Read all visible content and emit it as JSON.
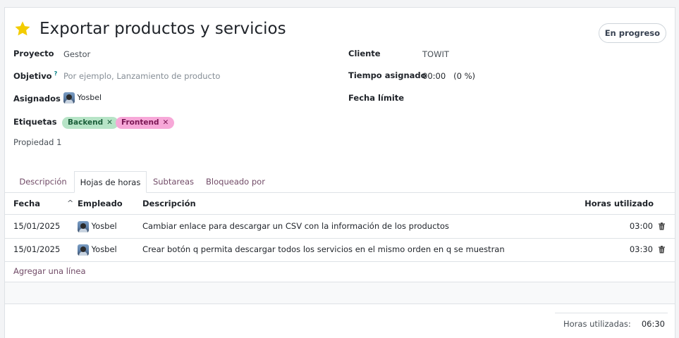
{
  "task": {
    "title": "Exportar productos y servicios",
    "stage": "En progreso",
    "star_color": "#f3cc00"
  },
  "fields": {
    "project": {
      "label": "Proyecto",
      "value": "Gestor"
    },
    "objective": {
      "label": "Objetivo",
      "help": "?",
      "placeholder": "Por ejemplo, Lanzamiento de producto"
    },
    "assignees": {
      "label": "Asignados",
      "value": "Yosbel"
    },
    "tags": {
      "label": "Etiquetas",
      "items": [
        {
          "name": "Backend",
          "color": "#b7e4c7"
        },
        {
          "name": "Frontend",
          "color": "#f7a8d8"
        }
      ]
    },
    "property": {
      "label": "Propiedad 1"
    },
    "customer": {
      "label": "Cliente",
      "value": "TOWIT"
    },
    "allocated": {
      "label": "Tiempo asignado",
      "value": "00:00",
      "percent": "(0 %)"
    },
    "deadline": {
      "label": "Fecha límite",
      "value": ""
    }
  },
  "tabs": [
    {
      "label": "Descripción",
      "active": false
    },
    {
      "label": "Hojas de horas",
      "active": true
    },
    {
      "label": "Subtareas",
      "active": false
    },
    {
      "label": "Bloqueado por",
      "active": false
    }
  ],
  "timesheet": {
    "columns": {
      "date": "Fecha",
      "employee": "Empleado",
      "description": "Descripción",
      "hours": "Horas utilizado"
    },
    "rows": [
      {
        "date": "15/01/2025",
        "employee": "Yosbel",
        "description": "Cambiar enlace para descargar un CSV con la información de los productos",
        "hours": "03:00"
      },
      {
        "date": "15/01/2025",
        "employee": "Yosbel",
        "description": "Crear botón q permita descargar todos los servicios en el mismo orden en q se muestran",
        "hours": "03:30"
      }
    ],
    "add_line": "Agregar una línea",
    "total_label": "Horas utilizadas:",
    "total_value": "06:30"
  },
  "colors": {
    "accent": "#714b67",
    "help": "#017e84"
  }
}
